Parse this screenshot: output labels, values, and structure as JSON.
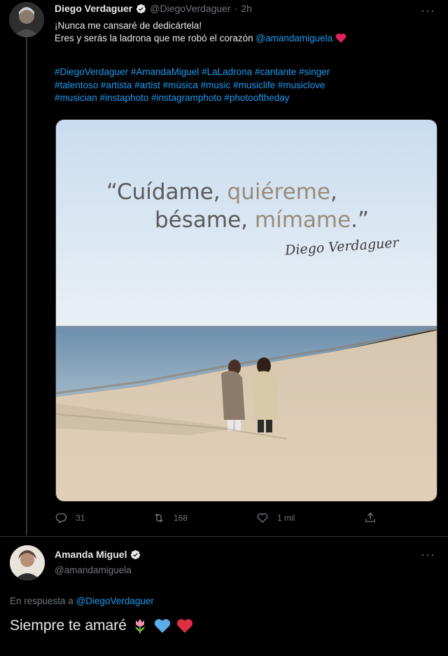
{
  "tweet": {
    "author_name": "Diego Verdaguer",
    "author_handle": "@DiegoVerdaguer",
    "time_sep": "·",
    "time": "2h",
    "more": "···",
    "line1": "¡Nunca me cansaré de dedicártela!",
    "line2_prefix": "Eres y serás la ladrona que me robó el corazón",
    "line2_mention": "@amandamiguela",
    "hashtags_line1": "#DiegoVerdaguer #AmandaMiguel  #LaLadrona #cantante #singer",
    "hashtags_line2": "#talentoso #artista #artist #música #music #musiclife #musiclove",
    "hashtags_line3": "#musician #instaphoto #instagramphoto #photooftheday",
    "media": {
      "quote_a": "“Cuídame, ",
      "quote_b": "quiéreme",
      "quote_c": ",",
      "quote_d": "bésame, ",
      "quote_e": "mímame",
      "quote_f": ".”",
      "signature": "Diego Verdaguer"
    },
    "actions": {
      "replies": "31",
      "retweets": "168",
      "likes": "1 mil"
    }
  },
  "reply": {
    "author_name": "Amanda Miguel",
    "author_handle": "@amandamiguela",
    "more": "···",
    "reply_label": "En respuesta a ",
    "reply_mention": "@DiegoVerdaguer",
    "text": "Siempre te amaré"
  },
  "icons": [
    "verified-badge-icon",
    "heart-icon",
    "reply-icon",
    "retweet-icon",
    "like-icon",
    "share-icon",
    "tulip-emoji-icon",
    "blue-heart-emoji-icon",
    "red-heart-emoji-icon"
  ],
  "colors": {
    "background": "#000000",
    "text": "#e7e9ea",
    "muted": "#71767b",
    "link": "#1d9bf0",
    "divider": "#2f3336"
  }
}
